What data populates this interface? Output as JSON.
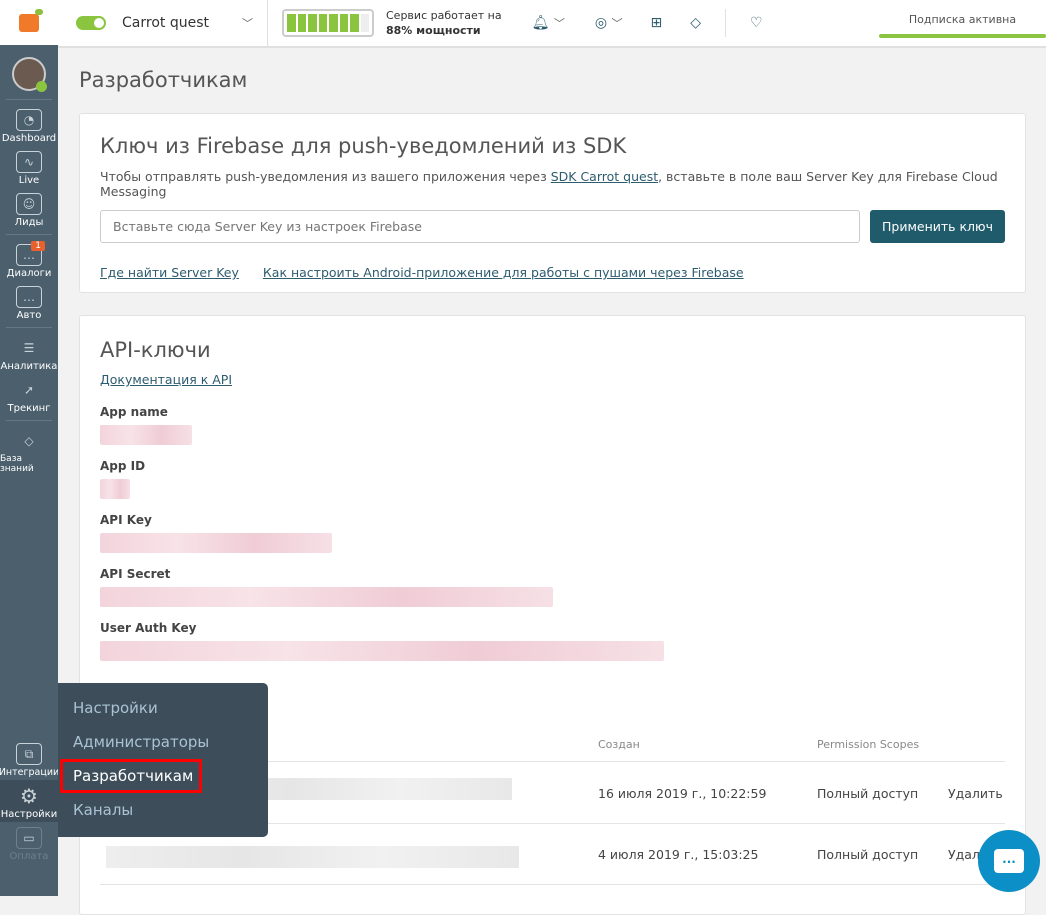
{
  "sidebar": {
    "items": [
      {
        "label": "Dashboard",
        "icon": "speedometer-icon"
      },
      {
        "label": "Live",
        "icon": "monitor-pulse-icon"
      },
      {
        "label": "Лиды",
        "icon": "users-icon"
      },
      {
        "label": "Диалоги",
        "icon": "chat-icon",
        "badge": "1"
      },
      {
        "label": "Авто",
        "icon": "auto-message-icon"
      },
      {
        "label": "Аналитика",
        "icon": "analytics-icon"
      },
      {
        "label": "Трекинг",
        "icon": "cursor-icon"
      },
      {
        "label": "База знаний",
        "icon": "graduation-cap-icon"
      },
      {
        "label": "Интеграции",
        "icon": "puzzle-icon"
      },
      {
        "label": "Настройки",
        "icon": "gear-icon"
      },
      {
        "label": "Оплата",
        "icon": "card-icon"
      }
    ]
  },
  "topbar": {
    "project": "Carrot quest",
    "service_line1": "Сервис работает на",
    "service_line2": "88% мощности",
    "capacity_percent": 88,
    "subscription": "Подписка активна"
  },
  "page_title": "Разработчикам",
  "firebase": {
    "title": "Ключ из Firebase для push-уведомлений из SDK",
    "desc_before": "Чтобы отправлять push-уведомления из вашего приложения через ",
    "desc_link": "SDK Carrot quest",
    "desc_after": ", вставьте в поле ваш Server Key для Firebase Cloud Messaging",
    "placeholder": "Вставьте сюда Server Key из настроек Firebase",
    "apply": "Применить ключ",
    "link1": "Где найти Server Key",
    "link2": "Как настроить Android-приложение для работы с пушами через Firebase"
  },
  "api": {
    "title": "API-ключи",
    "doc_link": "Документация к API",
    "fields": [
      "App name",
      "App ID",
      "API Key",
      "API Secret",
      "User Auth Key"
    ],
    "columns": {
      "created": "Создан",
      "scopes": "Permission Scopes"
    },
    "rows": [
      {
        "created": "16 июля 2019 г., 10:22:59",
        "scope": "Полный доступ",
        "action": "Удалить"
      },
      {
        "created": "4 июля 2019 г., 15:03:25",
        "scope": "Полный доступ",
        "action": "Удалить"
      }
    ]
  },
  "menu": {
    "items": [
      "Настройки",
      "Администраторы",
      "Разработчикам",
      "Каналы"
    ]
  },
  "chat_icon": "..."
}
